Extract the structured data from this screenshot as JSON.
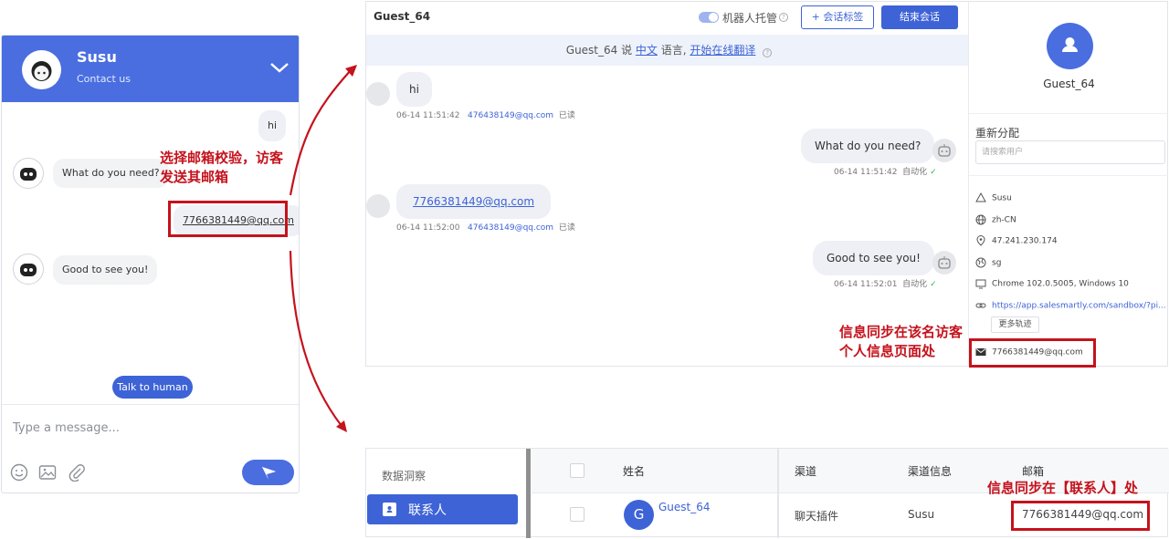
{
  "widget": {
    "title": "Susu",
    "subtitle": "Contact us",
    "messages": [
      {
        "from": "user",
        "text": "hi"
      },
      {
        "from": "bot",
        "text": "What do you need?"
      },
      {
        "from": "user",
        "text": "7766381449@qq.com"
      },
      {
        "from": "bot",
        "text": "Good to see you!"
      }
    ],
    "talk_to_human": "Talk to human",
    "input_placeholder": "Type a message..."
  },
  "annotations": {
    "note_email_verify": "选择邮箱校验，访客发送其邮箱",
    "note_visitor_info": "信息同步在该名访客个人信息页面处",
    "note_contacts": "信息同步在【联系人】处",
    "accent": "#c5121c"
  },
  "conversation": {
    "title": "Guest_64",
    "robot_label": "机器人托管",
    "tag_button": "会话标签",
    "end_button": "结束会话",
    "banner": {
      "prefix": "Guest_64 说 ",
      "lang": "中文",
      "mid": " 语言,  ",
      "action": "开始在线翻译"
    },
    "messages": [
      {
        "from": "visitor",
        "text": "hi",
        "time": "06-14 11:51:42",
        "email": "476438149@qq.com",
        "status": "已读"
      },
      {
        "from": "bot",
        "text": "What do you need?",
        "time": "06-14 11:51:42",
        "status": "自动化"
      },
      {
        "from": "visitor",
        "text": "7766381449@qq.com",
        "time": "06-14 11:52:00",
        "email": "476438149@qq.com",
        "status": "已读"
      },
      {
        "from": "bot",
        "text": "Good to see you!",
        "time": "06-14 11:52:01",
        "status": "自动化"
      }
    ]
  },
  "visitor_panel": {
    "name": "Guest_64",
    "reassign_label": "重新分配",
    "search_placeholder": "请搜索用户",
    "info": {
      "channel": "Susu",
      "language": "zh-CN",
      "ip": "47.241.230.174",
      "region": "sg",
      "browser": "Chrome 102.0.5005, Windows 10",
      "url": "https://app.salesmartly.com/sandbox/?pi...",
      "more_tracks": "更多轨迹",
      "email": "7766381449@qq.com"
    }
  },
  "contacts": {
    "nav_insights": "数据洞察",
    "nav_contacts": "联系人",
    "columns": [
      "姓名",
      "渠道",
      "渠道信息",
      "邮箱"
    ],
    "row": {
      "avatar_letter": "G",
      "name": "Guest_64",
      "channel": "聊天插件",
      "channel_info": "Susu",
      "email": "7766381449@qq.com"
    }
  }
}
